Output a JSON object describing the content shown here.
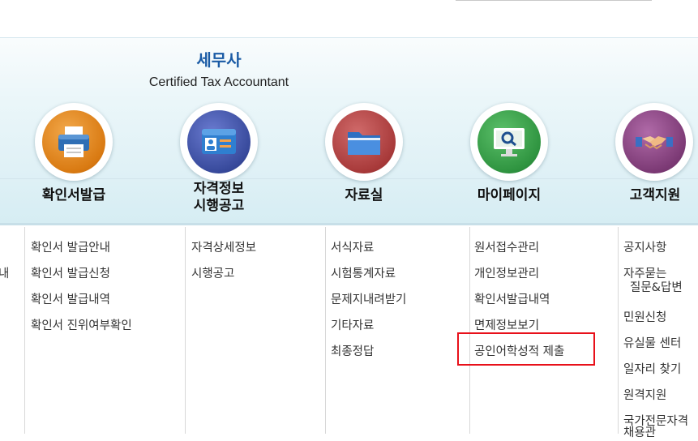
{
  "header": {
    "title": "세무사",
    "subtitle": "Certified Tax Accountant"
  },
  "menus": [
    {
      "label": "확인서발급",
      "icon": "printer-icon",
      "items": [
        "확인서 발급안내",
        "확인서 발급신청",
        "확인서 발급내역",
        "확인서 진위여부확인"
      ]
    },
    {
      "label_line1": "자격정보",
      "label_line2": "시행공고",
      "icon": "id-card-icon",
      "items": [
        "자격상세정보",
        "시행공고"
      ]
    },
    {
      "label": "자료실",
      "icon": "folder-icon",
      "items": [
        "서식자료",
        "시험통계자료",
        "문제지내려받기",
        "기타자료",
        "최종정답"
      ]
    },
    {
      "label": "마이페이지",
      "icon": "monitor-search-icon",
      "items": [
        "원서접수관리",
        "개인정보관리",
        "확인서발급내역",
        "면제정보보기",
        "공인어학성적 제출"
      ]
    },
    {
      "label": "고객지원",
      "icon": "handshake-icon",
      "items": [
        "공지사항",
        "자주묻는",
        "질문&답변",
        "민원신청",
        "유실물 센터",
        "일자리 찾기",
        "원격지원",
        "국가전문자격",
        "채용관"
      ]
    }
  ],
  "left_fragment": "내",
  "colors": {
    "title": "#1a5ba5",
    "highlight": "#e8101a"
  }
}
